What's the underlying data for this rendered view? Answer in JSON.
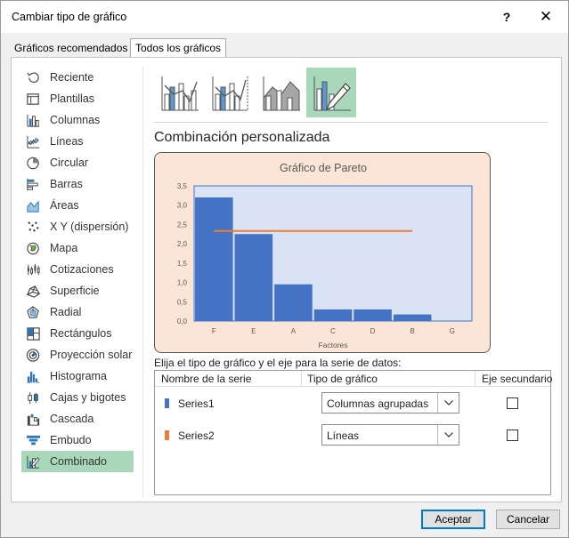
{
  "dialog": {
    "title": "Cambiar tipo de gráfico",
    "help_label": "?",
    "close_label": "✕"
  },
  "tabs": [
    {
      "label": "Gráficos recomendados",
      "active": false
    },
    {
      "label": "Todos los gráficos",
      "active": true
    }
  ],
  "sidebar": {
    "selected": "Combinado",
    "items": [
      {
        "label": "Reciente",
        "icon": "recent-icon"
      },
      {
        "label": "Plantillas",
        "icon": "templates-icon"
      },
      {
        "label": "Columnas",
        "icon": "column-chart-icon"
      },
      {
        "label": "Líneas",
        "icon": "line-chart-icon"
      },
      {
        "label": "Circular",
        "icon": "pie-chart-icon"
      },
      {
        "label": "Barras",
        "icon": "bar-chart-icon"
      },
      {
        "label": "Áreas",
        "icon": "area-chart-icon"
      },
      {
        "label": "X Y (dispersión)",
        "icon": "scatter-chart-icon"
      },
      {
        "label": "Mapa",
        "icon": "map-chart-icon"
      },
      {
        "label": "Cotizaciones",
        "icon": "stock-chart-icon"
      },
      {
        "label": "Superficie",
        "icon": "surface-chart-icon"
      },
      {
        "label": "Radial",
        "icon": "radar-chart-icon"
      },
      {
        "label": "Rectángulos",
        "icon": "treemap-chart-icon"
      },
      {
        "label": "Proyección solar",
        "icon": "sunburst-chart-icon"
      },
      {
        "label": "Histograma",
        "icon": "histogram-chart-icon"
      },
      {
        "label": "Cajas y bigotes",
        "icon": "box-whisker-chart-icon"
      },
      {
        "label": "Cascada",
        "icon": "waterfall-chart-icon"
      },
      {
        "label": "Embudo",
        "icon": "funnel-chart-icon"
      },
      {
        "label": "Combinado",
        "icon": "combo-chart-icon"
      }
    ]
  },
  "subtypes": [
    {
      "icon": "clustered-column-line-icon",
      "selected": false
    },
    {
      "icon": "clustered-column-line-secondary-axis-icon",
      "selected": false
    },
    {
      "icon": "stacked-area-clustered-column-icon",
      "selected": false
    },
    {
      "icon": "custom-combination-icon",
      "selected": true
    }
  ],
  "main": {
    "section_title": "Combinación personalizada",
    "series_caption": "Elija el tipo de gráfico y el eje para la serie de datos:"
  },
  "chart_data": {
    "type": "bar",
    "title": "Gráfico de Pareto",
    "xlabel": "Factores",
    "ylabel": "",
    "categories": [
      "F",
      "E",
      "A",
      "C",
      "D",
      "B",
      "G"
    ],
    "ylim": [
      0,
      3.5
    ],
    "yticks": [
      "0,0",
      "0,5",
      "1,0",
      "1,5",
      "2,0",
      "2,5",
      "3,0",
      "3,5"
    ],
    "series": [
      {
        "name": "Series1",
        "kind": "column",
        "color": "#4472c4",
        "values": [
          3.2,
          2.25,
          0.95,
          0.3,
          0.3,
          0.17,
          0
        ]
      },
      {
        "name": "Series2",
        "kind": "line",
        "color": "#ed7d31",
        "values": [
          2.33,
          2.33,
          2.33,
          2.33,
          2.33,
          2.33,
          2.33
        ]
      }
    ],
    "plot_background": "#dae3f3",
    "area_background": "#fbe5d6"
  },
  "series_table": {
    "headers": [
      "Nombre de la serie",
      "Tipo de gráfico",
      "Eje secundario"
    ],
    "rows": [
      {
        "name": "Series1",
        "color": "#4472c4",
        "chart_type": "Columnas agrupadas",
        "secondary": false
      },
      {
        "name": "Series2",
        "color": "#ed7d31",
        "chart_type": "Líneas",
        "secondary": false
      }
    ]
  },
  "buttons": {
    "ok": "Aceptar",
    "cancel": "Cancelar"
  },
  "colors": {
    "accent": "#0078d7",
    "selection": "#a8d8b9",
    "column": "#4472c4",
    "line": "#ed7d31"
  }
}
